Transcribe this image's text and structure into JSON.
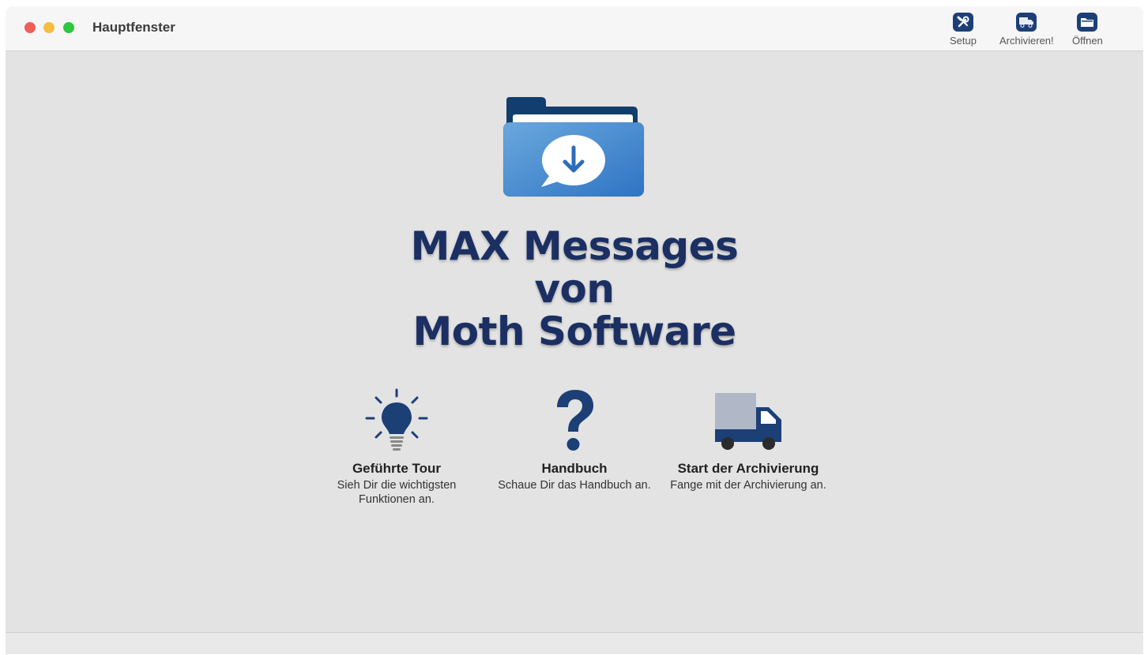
{
  "window": {
    "title": "Hauptfenster",
    "accent_color": "#1c3f76"
  },
  "toolbar": [
    {
      "label": "Setup",
      "icon": "wrench-screwdriver-icon"
    },
    {
      "label": "Archivieren!",
      "icon": "truck-icon"
    },
    {
      "label": "Öffnen",
      "icon": "folder-icon"
    }
  ],
  "hero": {
    "icon": "folder-download-icon",
    "line1": "MAX Messages",
    "line2": "von",
    "line3": "Moth Software"
  },
  "actions": [
    {
      "title": "Geführte Tour",
      "subtitle_line1": "Sieh Dir die wichtigsten",
      "subtitle_line2": "Funktionen an.",
      "icon": "lightbulb-icon"
    },
    {
      "title": "Handbuch",
      "subtitle_line1": "Schaue Dir das Handbuch an.",
      "subtitle_line2": "",
      "icon": "question-mark-icon"
    },
    {
      "title": "Start der Archivierung",
      "subtitle_line1": "Fange mit der Archivierung an.",
      "subtitle_line2": "",
      "icon": "delivery-truck-icon"
    }
  ]
}
